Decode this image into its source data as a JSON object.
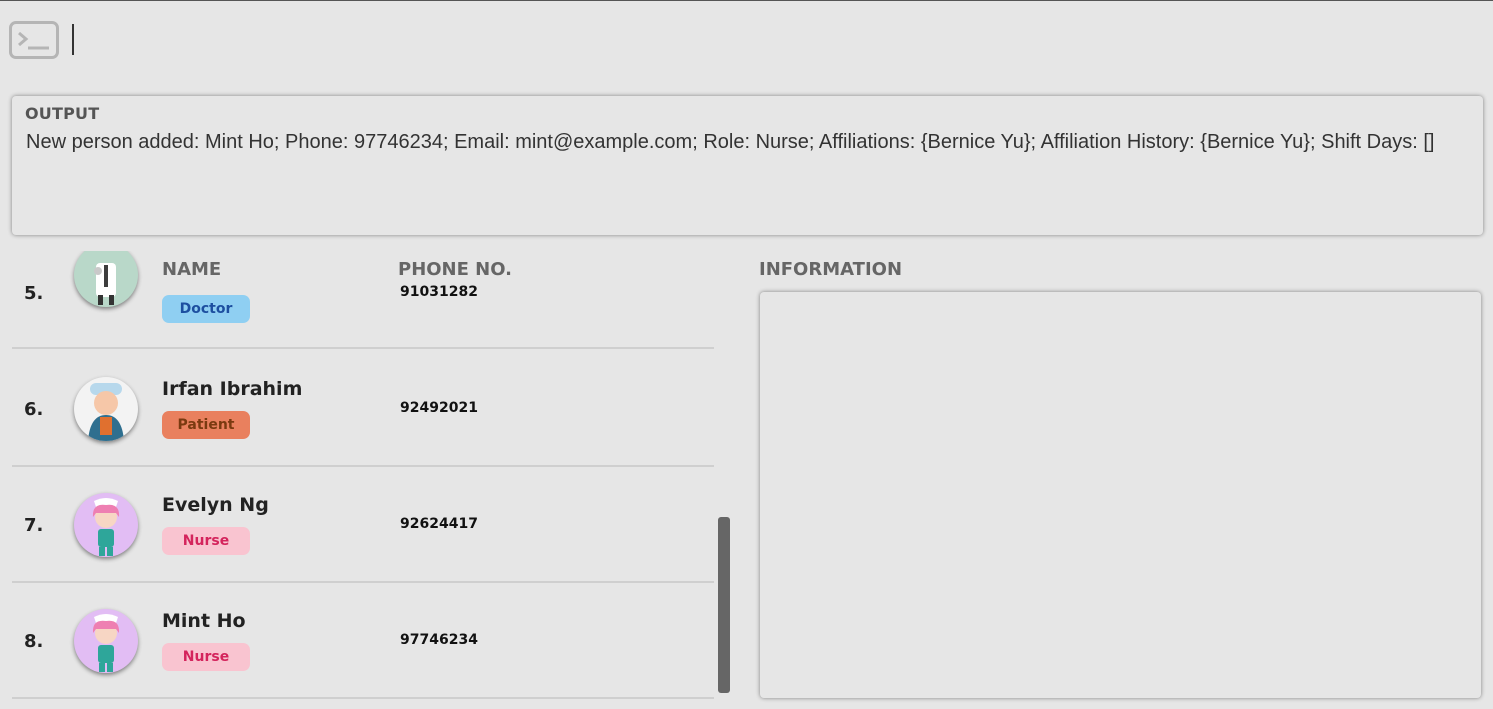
{
  "command": {
    "value": "",
    "icon": "terminal-icon"
  },
  "output": {
    "label": "OUTPUT",
    "text": "New person added: Mint Ho; Phone: 97746234; Email: mint@example.com; Role: Nurse; Affiliations: {Bernice Yu}; Affiliation History: {Bernice Yu}; Shift Days: []"
  },
  "list": {
    "headers": {
      "name": "NAME",
      "phone": "PHONE NO."
    },
    "rows": [
      {
        "index": "5.",
        "name": "",
        "role": "Doctor",
        "phone": "91031282",
        "avatar": "doctor-avatar-icon"
      },
      {
        "index": "6.",
        "name": "Irfan Ibrahim",
        "role": "Patient",
        "phone": "92492021",
        "avatar": "patient-avatar-icon"
      },
      {
        "index": "7.",
        "name": "Evelyn Ng",
        "role": "Nurse",
        "phone": "92624417",
        "avatar": "nurse-avatar-icon"
      },
      {
        "index": "8.",
        "name": "Mint Ho",
        "role": "Nurse",
        "phone": "97746234",
        "avatar": "nurse-avatar-icon"
      }
    ]
  },
  "information": {
    "label": "INFORMATION"
  },
  "colors": {
    "background": "#e6e6e6",
    "doctor_badge": "#8fcff2",
    "patient_badge": "#e9805e",
    "nurse_badge": "#f9c4d0"
  }
}
